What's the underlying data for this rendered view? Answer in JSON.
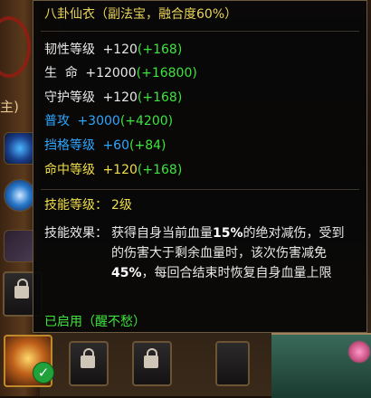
{
  "background": {
    "side_tag": "主)",
    "equipped_check": "✓"
  },
  "tooltip": {
    "title": "八卦仙衣（副法宝，融合度60%）",
    "stats": [
      {
        "label": "韧性等级",
        "base": "+120",
        "bonus": "(+168)",
        "color": "#e8e8e8"
      },
      {
        "label": "生  命",
        "base": "+12000",
        "bonus": "(+16800)",
        "color": "#e8e8e8"
      },
      {
        "label": "守护等级",
        "base": "+120",
        "bonus": "(+168)",
        "color": "#e8e8e8"
      },
      {
        "label": "普攻",
        "base": "+3000",
        "bonus": "(+4200)",
        "color": "#2ea6ff"
      },
      {
        "label": "挡格等级",
        "base": "+60",
        "bonus": "(+84)",
        "color": "#2ea6ff"
      },
      {
        "label": "命中等级",
        "base": "+120",
        "bonus": "(+168)",
        "color": "#f0de4a"
      }
    ],
    "skill_level_label": "技能等级：",
    "skill_level_value": "2级",
    "effect_label": "技能效果：",
    "effect_lines": [
      {
        "a": "获得自身当前血量",
        "b": "15%",
        "c": "的绝对减伤，受到"
      },
      {
        "a": "的伤害大于剩余血量时，该次伤害减免",
        "b": "",
        "c": ""
      },
      {
        "a": "",
        "b": "45%",
        "c": "，每回合结束时恢复自身血量上限"
      }
    ],
    "status": "已启用（醒不愁）"
  },
  "colors": {
    "title": "#e8d35a",
    "bonus": "#3ee43e",
    "blue_stat": "#2ea6ff",
    "yellow_stat": "#f0de4a",
    "status": "#3ee43e"
  }
}
